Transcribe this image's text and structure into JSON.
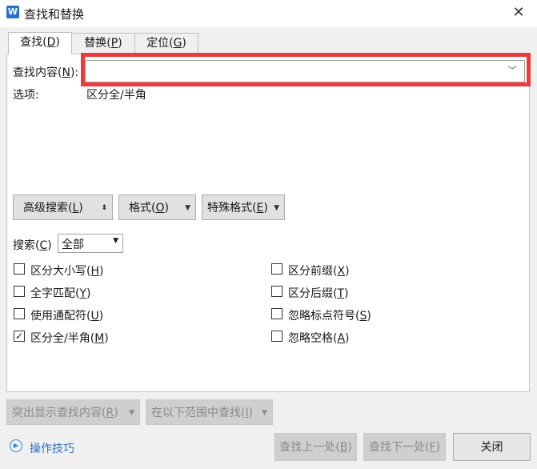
{
  "window": {
    "title": "查找和替换",
    "app_icon_letter": "W",
    "close_glyph": "✕"
  },
  "tabs": [
    {
      "label": "查找(",
      "key": "D",
      "suffix": ")"
    },
    {
      "label": "替换(",
      "key": "P",
      "suffix": ")"
    },
    {
      "label": "定位(",
      "key": "G",
      "suffix": ")"
    }
  ],
  "find": {
    "label": "查找内容(",
    "key": "N",
    "suffix": "):",
    "value": "",
    "chevron": "﹀"
  },
  "options": {
    "label": "选项:",
    "value": "区分全/半角"
  },
  "buttons": {
    "advanced": {
      "label": "高级搜索(",
      "key": "L",
      "suffix": ")",
      "arrow": "⬍"
    },
    "format": {
      "label": "格式(",
      "key": "O",
      "suffix": ")",
      "arrow": "▼"
    },
    "special": {
      "label": "特殊格式(",
      "key": "E",
      "suffix": ")",
      "arrow": "▼"
    }
  },
  "search": {
    "label": "搜索(",
    "key": "C",
    "suffix": ")",
    "selected": "全部",
    "arrow": "▼"
  },
  "checkboxes_left": [
    {
      "label": "区分大小写(",
      "key": "H",
      "suffix": ")",
      "checked": false
    },
    {
      "label": "全字匹配(",
      "key": "Y",
      "suffix": ")",
      "checked": false
    },
    {
      "label": "使用通配符(",
      "key": "U",
      "suffix": ")",
      "checked": false
    },
    {
      "label": "区分全/半角(",
      "key": "M",
      "suffix": ")",
      "checked": true
    }
  ],
  "checkboxes_right": [
    {
      "label": "区分前缀(",
      "key": "X",
      "suffix": ")",
      "checked": false
    },
    {
      "label": "区分后缀(",
      "key": "T",
      "suffix": ")",
      "checked": false
    },
    {
      "label": "忽略标点符号(",
      "key": "S",
      "suffix": ")",
      "checked": false
    },
    {
      "label": "忽略空格(",
      "key": "A",
      "suffix": ")",
      "checked": false
    }
  ],
  "bottom": {
    "highlight_all": {
      "label": "突出显示查找内容(",
      "key": "R",
      "suffix": ")",
      "arrow": "▼"
    },
    "find_in": {
      "label": "在以下范围中查找(",
      "key": "I",
      "suffix": ")",
      "arrow": "▼"
    },
    "tips": "操作技巧",
    "tips_glyph": "▶",
    "prev": {
      "label": "查找上一处(",
      "key": "B",
      "suffix": ")"
    },
    "next": {
      "label": "查找下一处(",
      "key": "F",
      "suffix": ")"
    },
    "close": "关闭"
  },
  "colors": {
    "highlight_border": "#ee3a3a",
    "link": "#2a6fd2",
    "app_icon": "#2b6fd6"
  }
}
